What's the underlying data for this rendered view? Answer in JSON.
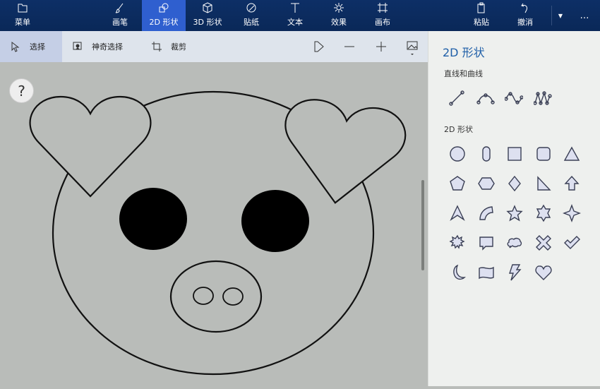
{
  "topbar": {
    "menu": "菜单",
    "tabs": [
      {
        "label": "画笔",
        "icon": "brush-icon"
      },
      {
        "label": "2D 形状",
        "icon": "2d-shapes-icon",
        "active": true
      },
      {
        "label": "3D 形状",
        "icon": "3d-shapes-icon"
      },
      {
        "label": "贴纸",
        "icon": "sticker-icon"
      },
      {
        "label": "文本",
        "icon": "text-icon"
      },
      {
        "label": "效果",
        "icon": "effects-icon"
      },
      {
        "label": "画布",
        "icon": "canvas-icon"
      }
    ],
    "paste": "粘贴",
    "undo": "撤消",
    "more": "…"
  },
  "toolbar": {
    "select": "选择",
    "magic_select": "神奇选择",
    "crop": "裁剪"
  },
  "canvas": {
    "help": "?"
  },
  "panel": {
    "title": "2D 形状",
    "lines_heading": "直线和曲线",
    "shapes_heading": "2D 形状",
    "lines": [
      "line-icon",
      "curve-icon",
      "s-curve-icon",
      "multi-curve-icon"
    ],
    "shapes": [
      "circle-icon",
      "capsule-icon",
      "square-icon",
      "rounded-square-icon",
      "triangle-icon",
      "pentagon-icon",
      "hexagon-icon",
      "diamond-icon",
      "right-triangle-icon",
      "arrow-up-icon",
      "pointer-arrow-icon",
      "arc-icon",
      "star5-icon",
      "star6-icon",
      "star4-icon",
      "burst-icon",
      "speech-bubble-icon",
      "thought-bubble-icon",
      "cross-icon",
      "check-icon",
      "moon-icon",
      "banner-icon",
      "lightning-icon",
      "heart-icon"
    ]
  },
  "colors": {
    "topbar": "#0b2a5c",
    "active_tab": "#2f5fcf",
    "canvas": "#b9bcb9",
    "accent": "#1f5fa8"
  }
}
